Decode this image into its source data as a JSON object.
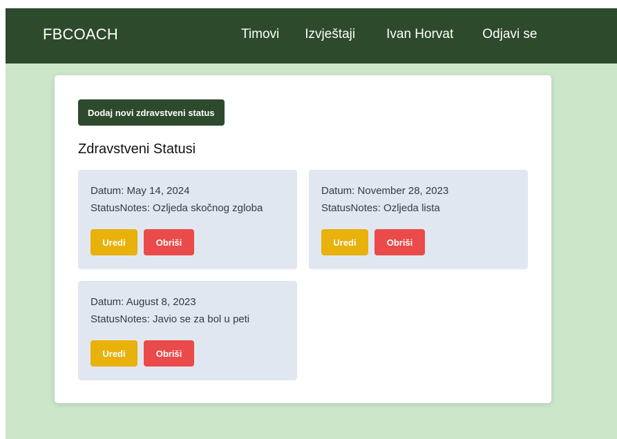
{
  "navbar": {
    "brand": "FBCOACH",
    "links": [
      "Timovi",
      "Izvještaji",
      "Ivan Horvat",
      "Odjavi se"
    ]
  },
  "main": {
    "add_button": "Dodaj novi zdravstveni status",
    "title": "Zdravstveni Statusi",
    "statuses": [
      {
        "date": "Datum: May 14, 2024",
        "notes": "StatusNotes: Ozljeda skočnog zgloba"
      },
      {
        "date": "Datum: November 28, 2023",
        "notes": "StatusNotes: Ozljeda lista"
      },
      {
        "date": "Datum: August 8, 2023",
        "notes": "StatusNotes: Javio se za bol u peti"
      }
    ],
    "edit_label": "Uredi",
    "delete_label": "Obriši"
  },
  "colors": {
    "navbar": "#2e4a2c",
    "background": "#cbe6c9",
    "card": "#ffffff",
    "status_item": "#e1e7f0",
    "edit": "#e8b10c",
    "delete": "#ea4a4a"
  }
}
